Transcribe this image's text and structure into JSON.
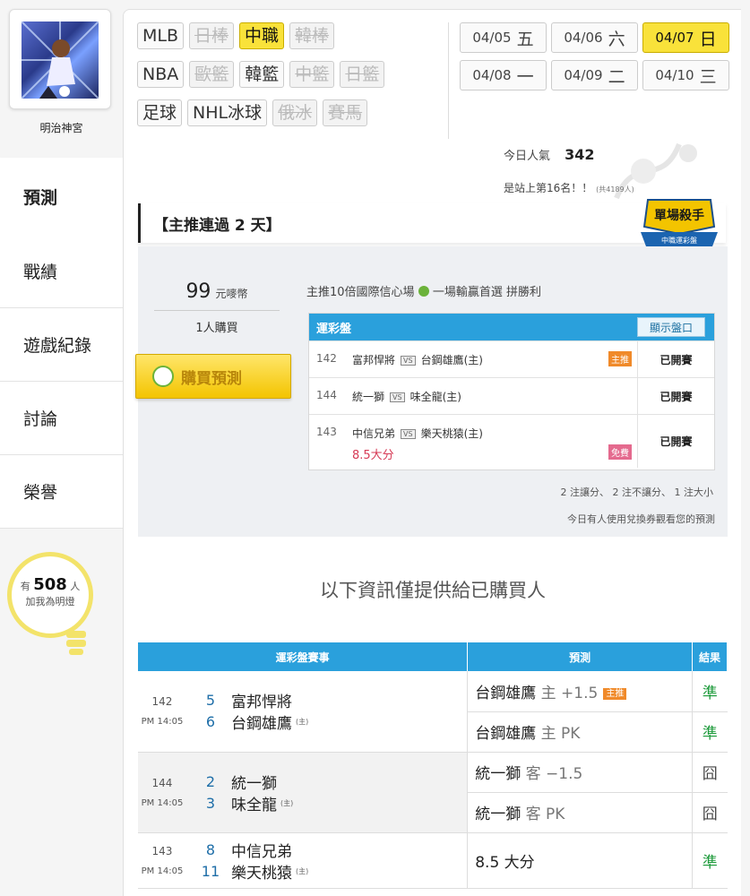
{
  "user": {
    "name": "明治神宮"
  },
  "nav": [
    {
      "label": "預測",
      "active": true
    },
    {
      "label": "戰績"
    },
    {
      "label": "遊戲紀錄"
    },
    {
      "label": "討論"
    },
    {
      "label": "榮譽"
    }
  ],
  "bulb": {
    "prefix": "有",
    "count": "508",
    "suffix": "人",
    "line2": "加我為明燈"
  },
  "leagues": {
    "row1": [
      "MLB",
      "日棒",
      "中職",
      "韓棒"
    ],
    "row2": [
      "NBA",
      "歐籃",
      "韓籃",
      "中籃",
      "日籃"
    ],
    "row3": [
      "足球",
      "NHL冰球",
      "俄冰",
      "賽馬"
    ]
  },
  "dates": [
    {
      "date": "04/05",
      "day": "五"
    },
    {
      "date": "04/06",
      "day": "六"
    },
    {
      "date": "04/07",
      "day": "日"
    },
    {
      "date": "04/08",
      "day": "一"
    },
    {
      "date": "04/09",
      "day": "二"
    },
    {
      "date": "04/10",
      "day": "三"
    }
  ],
  "popularity": {
    "label": "今日人氣",
    "value": "342"
  },
  "rank": {
    "text": "是站上第16名！！",
    "total": "(共4189人)"
  },
  "card": {
    "title": "【主推連過 2 天】",
    "badge_main": "單場殺手",
    "badge_sub": "中職運彩盤",
    "price": "99",
    "price_unit": "元嘜幣",
    "buyers": "1人購買",
    "buy_label": "購買預測",
    "pick_title_a": "主推10倍國際信心場",
    "pick_title_b": "一場輸贏首選 拼勝利",
    "odds_title": "運彩盤",
    "show_label": "顯示盤口",
    "vs": "VS",
    "summary": "2 注讓分、 2 注不讓分、 1 注大小",
    "note": "今日有人使用兌換券觀看您的預測",
    "odds": [
      {
        "id": "142",
        "away": "富邦悍將",
        "home": "台鋼雄鷹(主)",
        "tag": "主推",
        "status": "已開賽"
      },
      {
        "id": "144",
        "away": "統一獅",
        "home": "味全龍(主)",
        "status": "已開賽"
      },
      {
        "id": "143",
        "away": "中信兄弟",
        "home": "樂天桃猿(主)",
        "side": "8.5大分",
        "tag": "免費",
        "status": "已開賽"
      }
    ]
  },
  "info_text": "以下資訊僅提供給已購買人",
  "results": {
    "headers": [
      "運彩盤賽事",
      "預測",
      "結果"
    ],
    "home_mark": "(主)",
    "games": [
      {
        "id": "142",
        "time": "PM 14:05",
        "away": {
          "score": "5",
          "name": "富邦悍將"
        },
        "home": {
          "score": "6",
          "name": "台鋼雄鷹"
        },
        "picks": [
          {
            "team": "台鋼雄鷹",
            "note": "主 +1.5",
            "tag": "主推",
            "result": "準"
          },
          {
            "team": "台鋼雄鷹",
            "note": "主 PK",
            "result": "準"
          }
        ]
      },
      {
        "id": "144",
        "time": "PM 14:05",
        "away": {
          "score": "2",
          "name": "統一獅"
        },
        "home": {
          "score": "3",
          "name": "味全龍"
        },
        "picks": [
          {
            "team": "統一獅",
            "note": "客 −1.5",
            "result": "囧"
          },
          {
            "team": "統一獅",
            "note": "客 PK",
            "result": "囧"
          }
        ]
      },
      {
        "id": "143",
        "time": "PM 14:05",
        "away": {
          "score": "8",
          "name": "中信兄弟"
        },
        "home": {
          "score": "11",
          "name": "樂天桃猿"
        },
        "picks": [
          {
            "team": "8.5 大分",
            "note": "",
            "result": "準"
          }
        ]
      }
    ]
  },
  "colors": {
    "accent_blue": "#2aa0dc",
    "highlight_yellow": "#f9e23a",
    "hit_green": "#1c9a3a"
  }
}
